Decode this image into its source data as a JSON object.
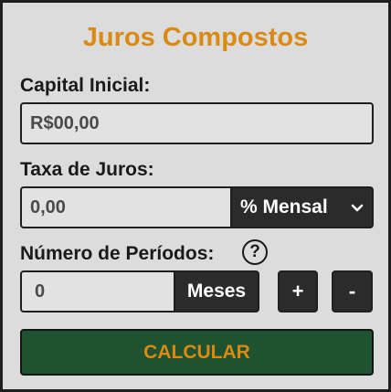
{
  "title": "Juros Compostos",
  "capital": {
    "label": "Capital Inicial:",
    "value": "R$00,00"
  },
  "taxa": {
    "label": "Taxa de Juros:",
    "value": "0,00",
    "period_selected": "% Mensal"
  },
  "periodos": {
    "label": "Número de Períodos:",
    "help_symbol": "?",
    "value": "0",
    "unit": "Meses",
    "plus": "+",
    "minus": "-"
  },
  "calculate_label": "CALCULAR",
  "icons": {
    "help": "help-icon",
    "dropdown": "chevron-down-icon"
  },
  "colors": {
    "accent": "#d98a12",
    "calc_bg": "#1f5230",
    "dark": "#2b2b2b"
  }
}
